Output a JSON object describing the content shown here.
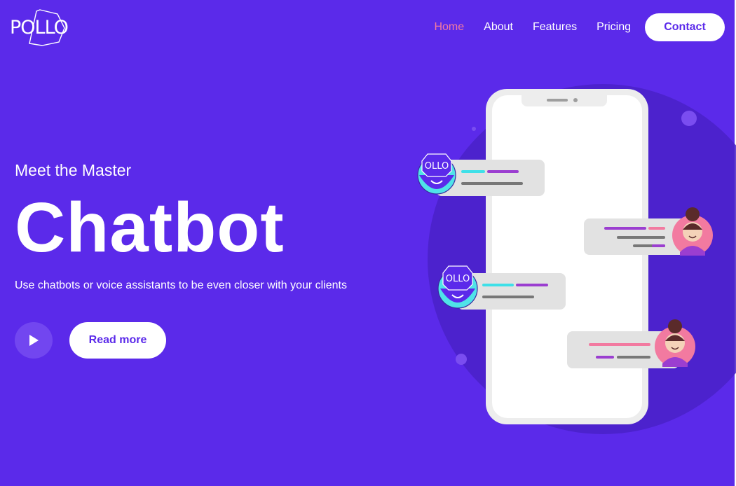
{
  "brand": {
    "logo_text": "POLLO"
  },
  "nav": {
    "items": [
      {
        "label": "Home",
        "active": true
      },
      {
        "label": "About",
        "active": false
      },
      {
        "label": "Features",
        "active": false
      },
      {
        "label": "Pricing",
        "active": false
      }
    ],
    "cta_label": "Contact"
  },
  "hero": {
    "kicker": "Meet the Master",
    "headline": "Chatbot",
    "description": "Use chatbots or voice assistants to be even closer with your clients",
    "read_more_label": "Read more"
  },
  "illustration": {
    "bot_avatar_label": "OLLO"
  },
  "colors": {
    "background": "#5b2aea",
    "accent_pink": "#f27aa0",
    "bubble": "#e2e2e2",
    "cyan": "#3ee0e8",
    "purple": "#9b3ed0"
  }
}
